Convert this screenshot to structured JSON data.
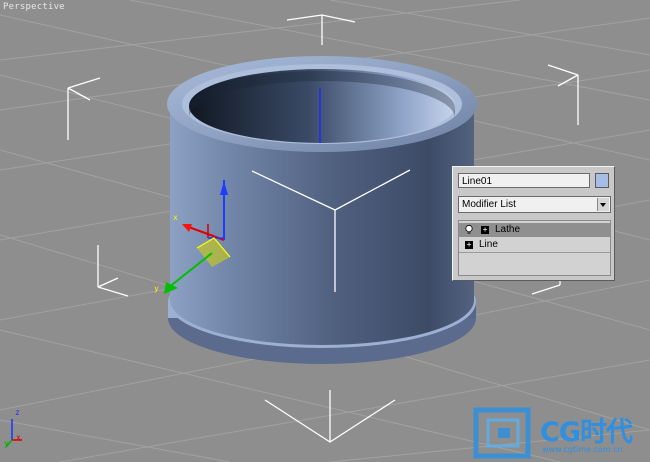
{
  "viewport": {
    "label": "Perspective"
  },
  "axis_tripod": {
    "x_label": "x",
    "y_label": "y",
    "z_label": "z"
  },
  "gizmo": {
    "x_label": "x",
    "y_label": "y"
  },
  "modifier_panel": {
    "object_name": "Line01",
    "object_color": "#a6bde6",
    "modifier_list_label": "Modifier List",
    "stack": [
      {
        "label": "Lathe",
        "selected": true,
        "icon": "lightbulb-icon"
      },
      {
        "label": "Line",
        "selected": false,
        "icon": ""
      }
    ]
  },
  "watermark": {
    "brand": "CG时代",
    "url": "www.cgtime.com.cn"
  },
  "colors": {
    "background": "#8e8e8e",
    "grid": "#a2a2a2",
    "object": "#7d90b0",
    "bracket": "#ffffff"
  }
}
